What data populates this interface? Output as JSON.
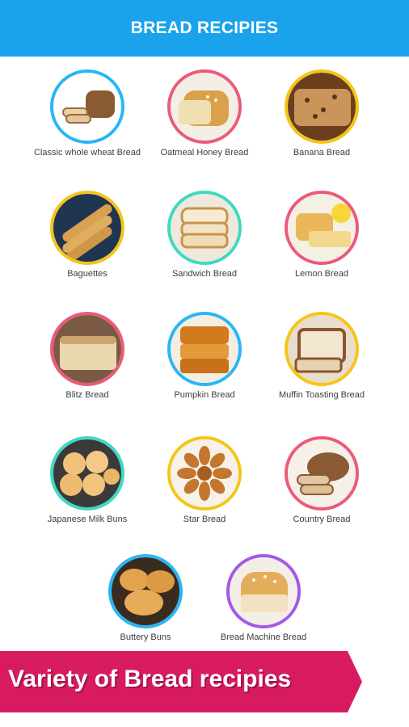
{
  "header": {
    "title": "BREAD RECIPIES"
  },
  "recipes": [
    {
      "label": "Classic whole wheat Bread",
      "ring": "#29b6f6",
      "icon": "whole-wheat-bread-icon"
    },
    {
      "label": "Oatmeal Honey Bread",
      "ring": "#ec5a7a",
      "icon": "oatmeal-honey-bread-icon"
    },
    {
      "label": "Banana Bread",
      "ring": "#f5c518",
      "icon": "banana-bread-icon"
    },
    {
      "label": "Baguettes",
      "ring": "#f5c518",
      "icon": "baguettes-icon"
    },
    {
      "label": "Sandwich Bread",
      "ring": "#3fd9c2",
      "icon": "sandwich-bread-icon"
    },
    {
      "label": "Lemon Bread",
      "ring": "#ec5a7a",
      "icon": "lemon-bread-icon"
    },
    {
      "label": "Blitz Bread",
      "ring": "#ec5a7a",
      "icon": "blitz-bread-icon"
    },
    {
      "label": "Pumpkin Bread",
      "ring": "#29b6f6",
      "icon": "pumpkin-bread-icon"
    },
    {
      "label": "Muffin Toasting Bread",
      "ring": "#f5c518",
      "icon": "muffin-toasting-bread-icon"
    },
    {
      "label": "Japanese Milk Buns",
      "ring": "#3fd9c2",
      "icon": "milk-buns-icon"
    },
    {
      "label": "Star Bread",
      "ring": "#f5c518",
      "icon": "star-bread-icon"
    },
    {
      "label": "Country Bread",
      "ring": "#ec5a7a",
      "icon": "country-bread-icon"
    },
    {
      "label": "Buttery Buns",
      "ring": "#29b6f6",
      "icon": "buttery-buns-icon"
    },
    {
      "label": "Bread Machine Bread",
      "ring": "#a259e6",
      "icon": "bread-machine-bread-icon"
    }
  ],
  "banner": {
    "text": "Variety of Bread recipies"
  },
  "colors": {
    "header": "#1aa3ec",
    "banner": "#d81b60"
  }
}
